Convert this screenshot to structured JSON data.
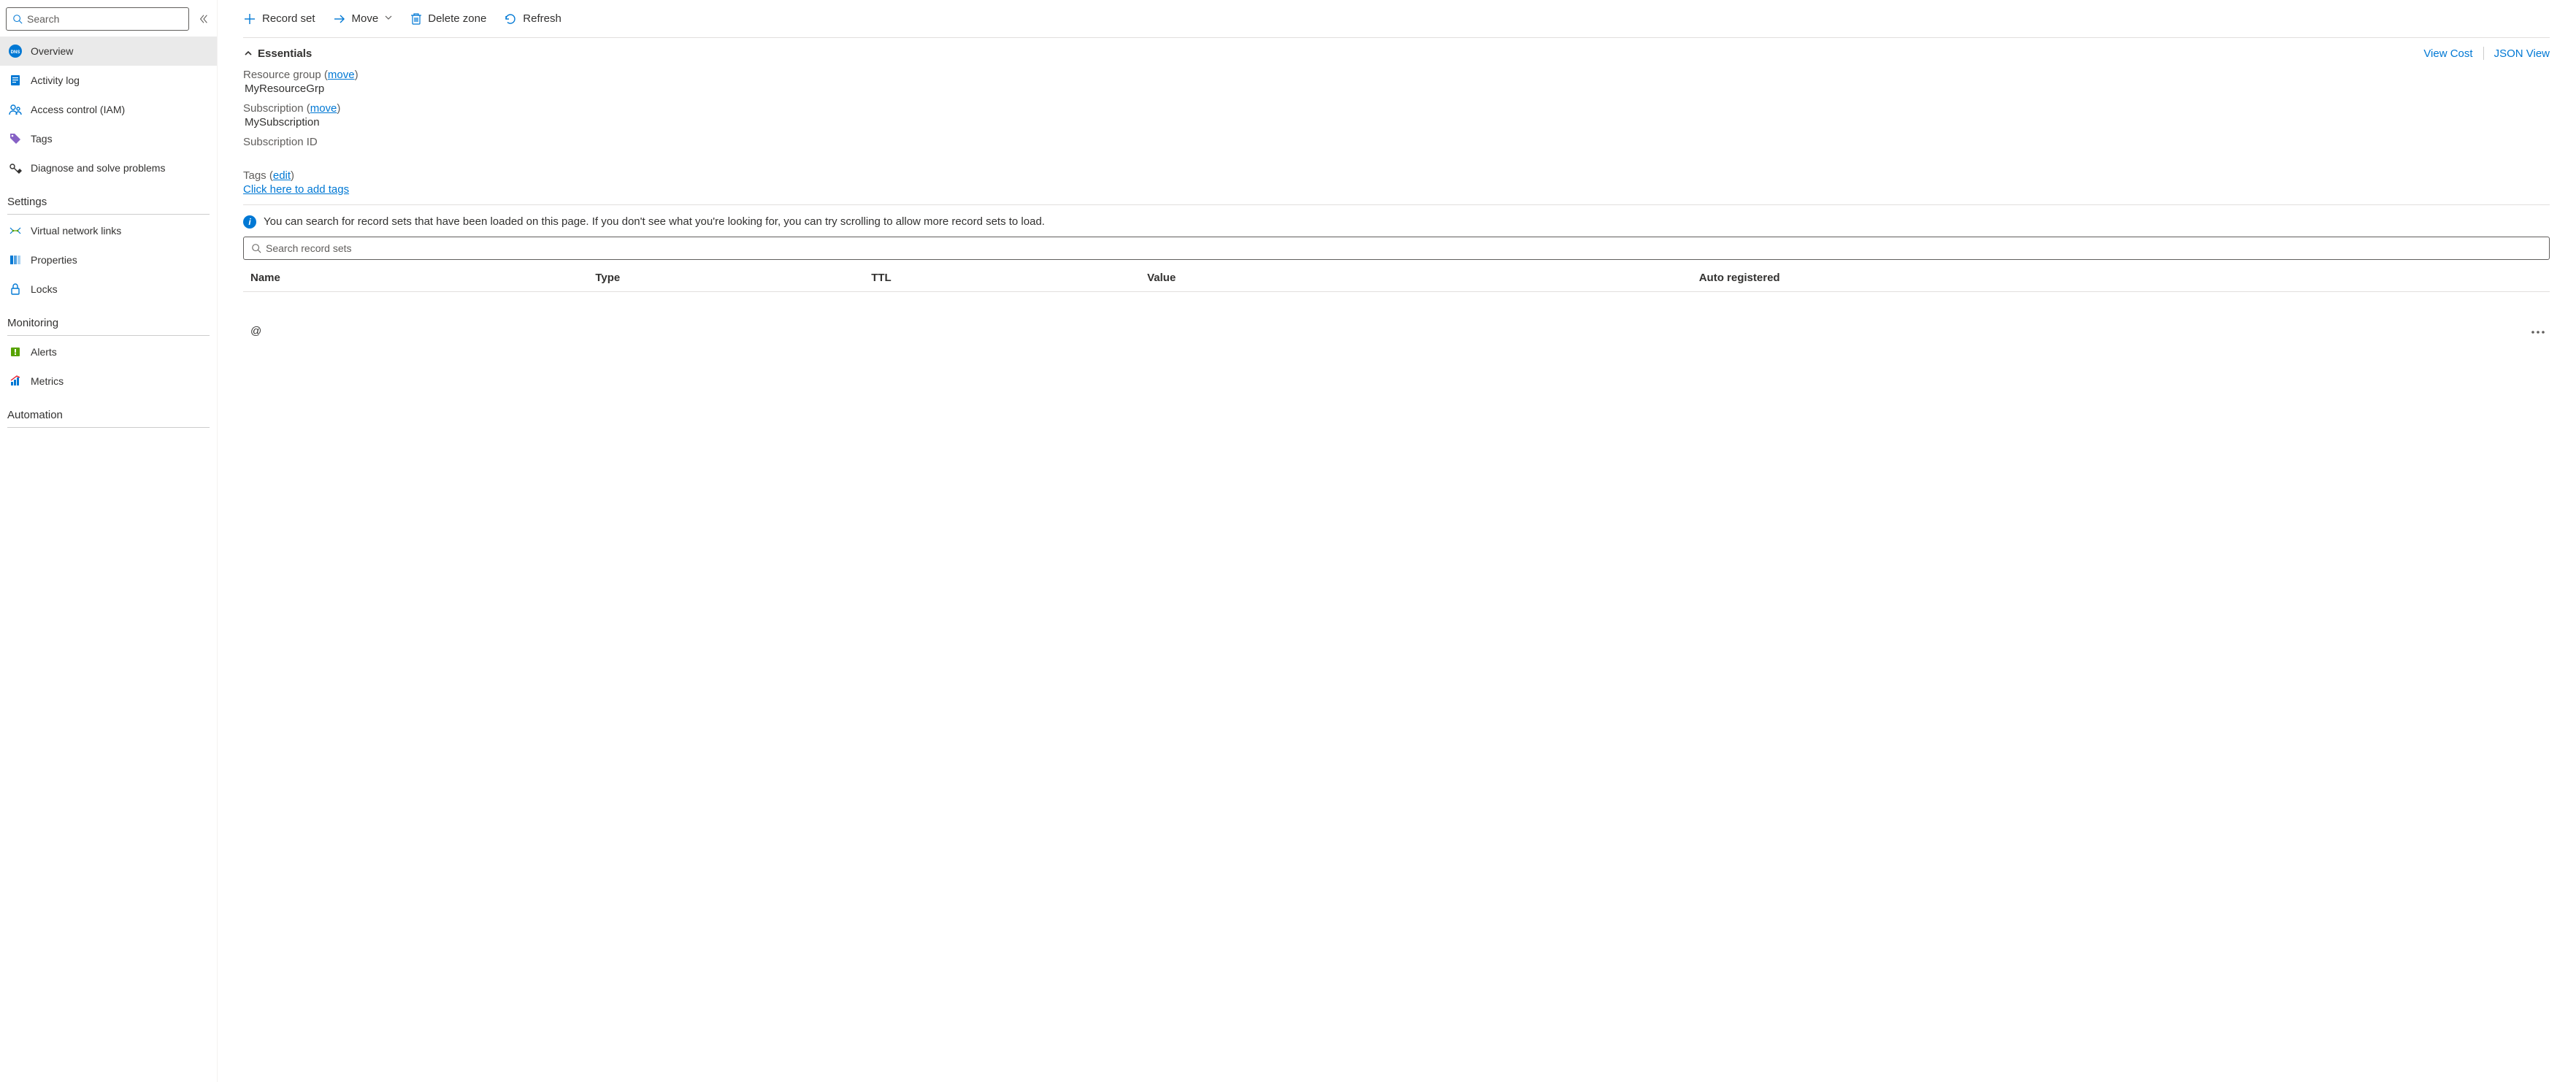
{
  "sidebar": {
    "search_placeholder": "Search",
    "items": [
      {
        "label": "Overview",
        "icon": "dns-circle-icon",
        "active": true
      },
      {
        "label": "Activity log",
        "icon": "activity-log-icon",
        "active": false
      },
      {
        "label": "Access control (IAM)",
        "icon": "access-control-icon",
        "active": false
      },
      {
        "label": "Tags",
        "icon": "tags-icon",
        "active": false
      },
      {
        "label": "Diagnose and solve problems",
        "icon": "diagnose-icon",
        "active": false
      }
    ],
    "sections": [
      {
        "heading": "Settings",
        "items": [
          {
            "label": "Virtual network links",
            "icon": "vnet-links-icon"
          },
          {
            "label": "Properties",
            "icon": "properties-icon"
          },
          {
            "label": "Locks",
            "icon": "locks-icon"
          }
        ]
      },
      {
        "heading": "Monitoring",
        "items": [
          {
            "label": "Alerts",
            "icon": "alerts-icon"
          },
          {
            "label": "Metrics",
            "icon": "metrics-icon"
          }
        ]
      },
      {
        "heading": "Automation",
        "items": []
      }
    ]
  },
  "toolbar": {
    "record_set": "Record set",
    "move": "Move",
    "delete_zone": "Delete zone",
    "refresh": "Refresh"
  },
  "essentials": {
    "title": "Essentials",
    "view_cost": "View Cost",
    "json_view": "JSON View",
    "fields": {
      "resource_group_label": "Resource group",
      "resource_group_move": "move",
      "resource_group_value": "MyResourceGrp",
      "subscription_label": "Subscription",
      "subscription_move": "move",
      "subscription_value": "MySubscription",
      "subscription_id_label": "Subscription ID",
      "tags_label": "Tags",
      "tags_edit": "edit",
      "tags_add_link": "Click here to add tags"
    }
  },
  "info_banner": "You can search for record sets that have been loaded on this page. If you don't see what you're looking for, you can try scrolling to allow more record sets to load.",
  "records": {
    "search_placeholder": "Search record sets",
    "columns": {
      "name": "Name",
      "type": "Type",
      "ttl": "TTL",
      "value": "Value",
      "auto": "Auto registered"
    },
    "rows": [
      {
        "name": "@"
      }
    ]
  }
}
